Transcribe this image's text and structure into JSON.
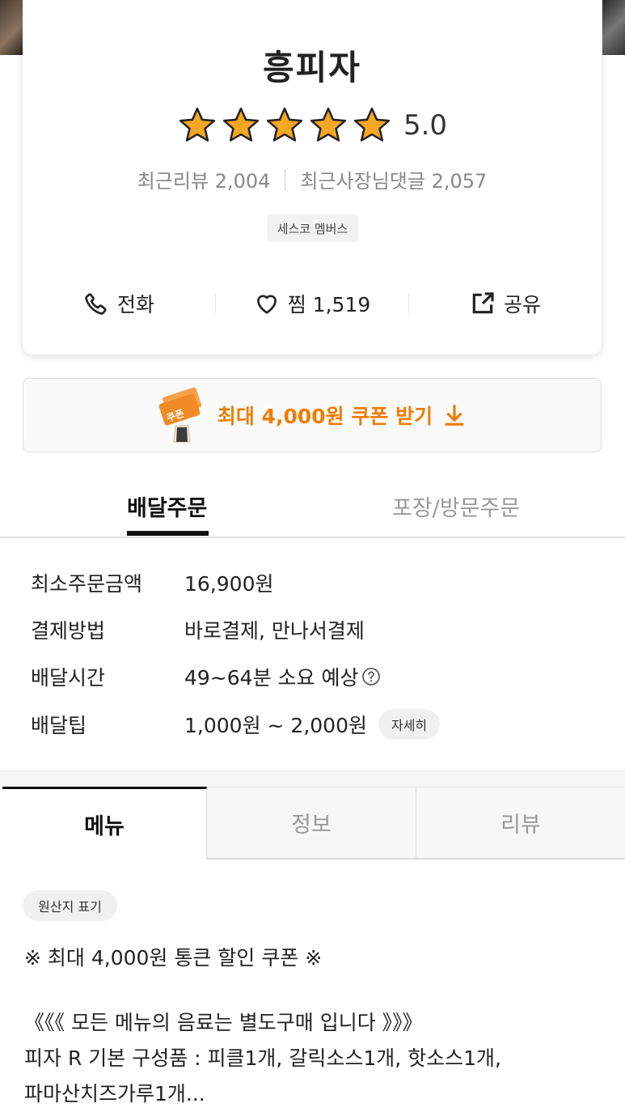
{
  "store": {
    "name": "흥피자",
    "rating": "5.0",
    "rating_stars": 5,
    "recent_reviews": "최근리뷰 2,004",
    "owner_replies": "최근사장님댓글 2,057",
    "badge": "세스코 멤버스"
  },
  "actions": {
    "call": "전화",
    "like": "찜 1,519",
    "share": "공유"
  },
  "coupon": {
    "label": "최대 4,000원 쿠폰 받기",
    "image_text": "쿠폰"
  },
  "order_tabs": {
    "delivery": "배달주문",
    "pickup": "포장/방문주문"
  },
  "delivery_info": [
    {
      "label": "최소주문금액",
      "value": "16,900원"
    },
    {
      "label": "결제방법",
      "value": "바로결제, 만나서결제"
    },
    {
      "label": "배달시간",
      "value": "49~64분 소요 예상"
    },
    {
      "label": "배달팁",
      "value": "1,000원 ~ 2,000원"
    }
  ],
  "detail_button": "자세히",
  "menu_tabs": {
    "menu": "메뉴",
    "info": "정보",
    "review": "리뷰"
  },
  "origin_button": "원산지 표기",
  "notices": {
    "line1": "※ 최대 4,000원 통큰 할인 쿠폰 ※",
    "line2": "《《《 모든 메뉴의 음료는 별도구매 입니다 》》》",
    "line3": "피자 R 기본 구성품 : 피클1개, 갈릭소스1개, 핫소스1개,",
    "line4": "파마산치즈가루1개..."
  },
  "colors": {
    "accent": "#f07c00",
    "star": "#f5a623",
    "text": "#222222",
    "muted": "#999999"
  }
}
